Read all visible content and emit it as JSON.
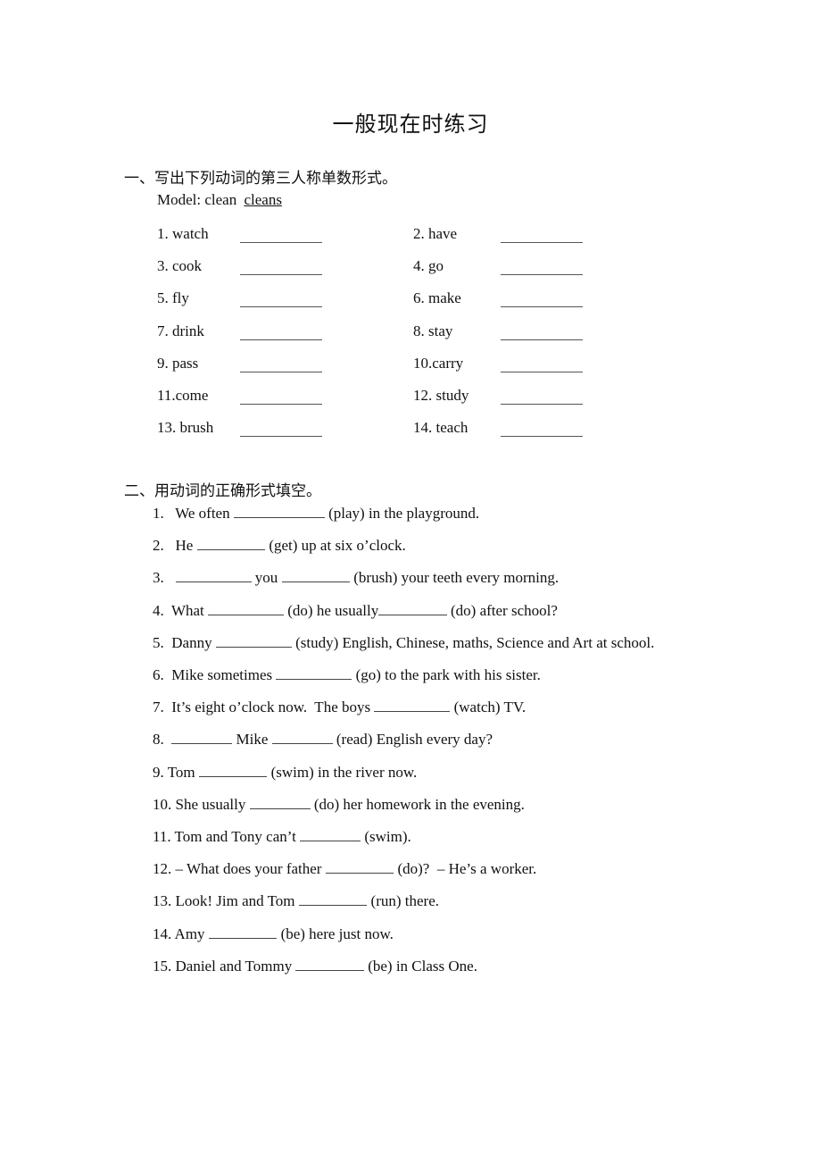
{
  "title": "一般现在时练习",
  "section1": {
    "heading": "一、写出下列动词的第三人称单数形式。",
    "model_label": "Model:  clean",
    "model_answer": "cleans",
    "items": [
      {
        "label": "1. watch"
      },
      {
        "label": "2. have"
      },
      {
        "label": "3. cook"
      },
      {
        "label": "4. go"
      },
      {
        "label": "5. fly"
      },
      {
        "label": "6. make"
      },
      {
        "label": "7. drink"
      },
      {
        "label": "8. stay"
      },
      {
        "label": "9. pass"
      },
      {
        "label": "10.carry"
      },
      {
        "label": "11.come"
      },
      {
        "label": "12. study"
      },
      {
        "label": "13. brush"
      },
      {
        "label": "14. teach"
      }
    ]
  },
  "section2": {
    "heading": "二、用动词的正确形式填空。",
    "sentences": [
      {
        "parts": [
          "1.   We often ",
          "__12",
          " (play) in the playground."
        ]
      },
      {
        "parts": [
          "2.   He ",
          "__9",
          " (get) up at six o’clock."
        ]
      },
      {
        "parts": [
          "3.   ",
          "__10",
          " you ",
          "__9",
          " (brush) your teeth every morning."
        ]
      },
      {
        "parts": [
          "4.  What ",
          "__10",
          " (do) he usually",
          "__9",
          " (do) after school?"
        ]
      },
      {
        "parts": [
          "5.  Danny ",
          "__10",
          " (study) English, Chinese, maths, Science and Art at school."
        ]
      },
      {
        "parts": [
          "6.  Mike sometimes ",
          "__10",
          " (go) to the park with his sister."
        ]
      },
      {
        "parts": [
          "7.  It’s eight o’clock now.  The boys ",
          "__10",
          " (watch) TV."
        ]
      },
      {
        "parts": [
          "8.  ",
          "__8",
          " Mike ",
          "__8",
          " (read) English every day?"
        ]
      },
      {
        "parts": [
          "9. Tom ",
          "__9",
          " (swim) in the river now."
        ]
      },
      {
        "parts": [
          "10. She usually ",
          "__8",
          " (do) her homework in the evening."
        ]
      },
      {
        "parts": [
          "11. Tom and Tony can’t ",
          "__8",
          " (swim)."
        ]
      },
      {
        "parts": [
          "12. – What does your father ",
          "__9",
          " (do)?  – He’s a worker."
        ]
      },
      {
        "parts": [
          "13. Look! Jim and Tom ",
          "__9",
          " (run) there."
        ]
      },
      {
        "parts": [
          "14. Amy ",
          "__9",
          " (be) here just now."
        ]
      },
      {
        "parts": [
          "15. Daniel and Tommy ",
          "__9",
          " (be) in Class One."
        ]
      }
    ]
  }
}
